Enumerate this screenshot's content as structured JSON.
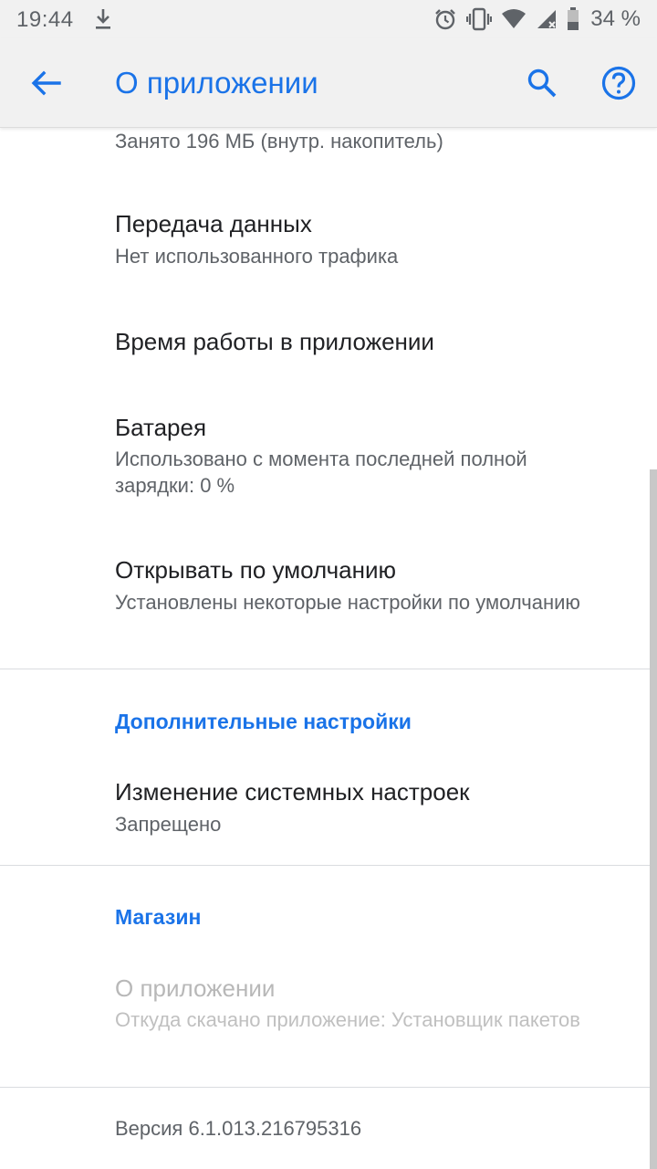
{
  "status_bar": {
    "time": "19:44",
    "battery_percent": "34 %",
    "icons": [
      "download-icon",
      "alarm-icon",
      "vibrate-icon",
      "wifi-icon",
      "signal-icon",
      "battery-icon"
    ]
  },
  "app_bar": {
    "title": "О приложении",
    "icons": [
      "back-arrow-icon",
      "search-icon",
      "help-icon"
    ],
    "accent_color": "#1a73e8"
  },
  "items": {
    "storage_summary": "Занято 196 МБ (внутр. накопитель)",
    "data_usage": {
      "title": "Передача данных",
      "summary": "Нет использованного трафика"
    },
    "screen_time": {
      "title": "Время работы в приложении"
    },
    "battery": {
      "title": "Батарея",
      "summary": "Использовано с момента последней полной зарядки: 0 %"
    },
    "open_by_default": {
      "title": "Открывать по умолчанию",
      "summary": "Установлены некоторые настройки по умолчанию"
    }
  },
  "advanced": {
    "header": "Дополнительные настройки",
    "modify_settings": {
      "title": "Изменение системных настроек",
      "summary": "Запрещено"
    }
  },
  "store": {
    "header": "Магазин",
    "app_details": {
      "title": "О приложении",
      "summary": "Откуда скачано приложение: Установщик пакетов"
    }
  },
  "version": "Версия 6.1.013.216795316"
}
